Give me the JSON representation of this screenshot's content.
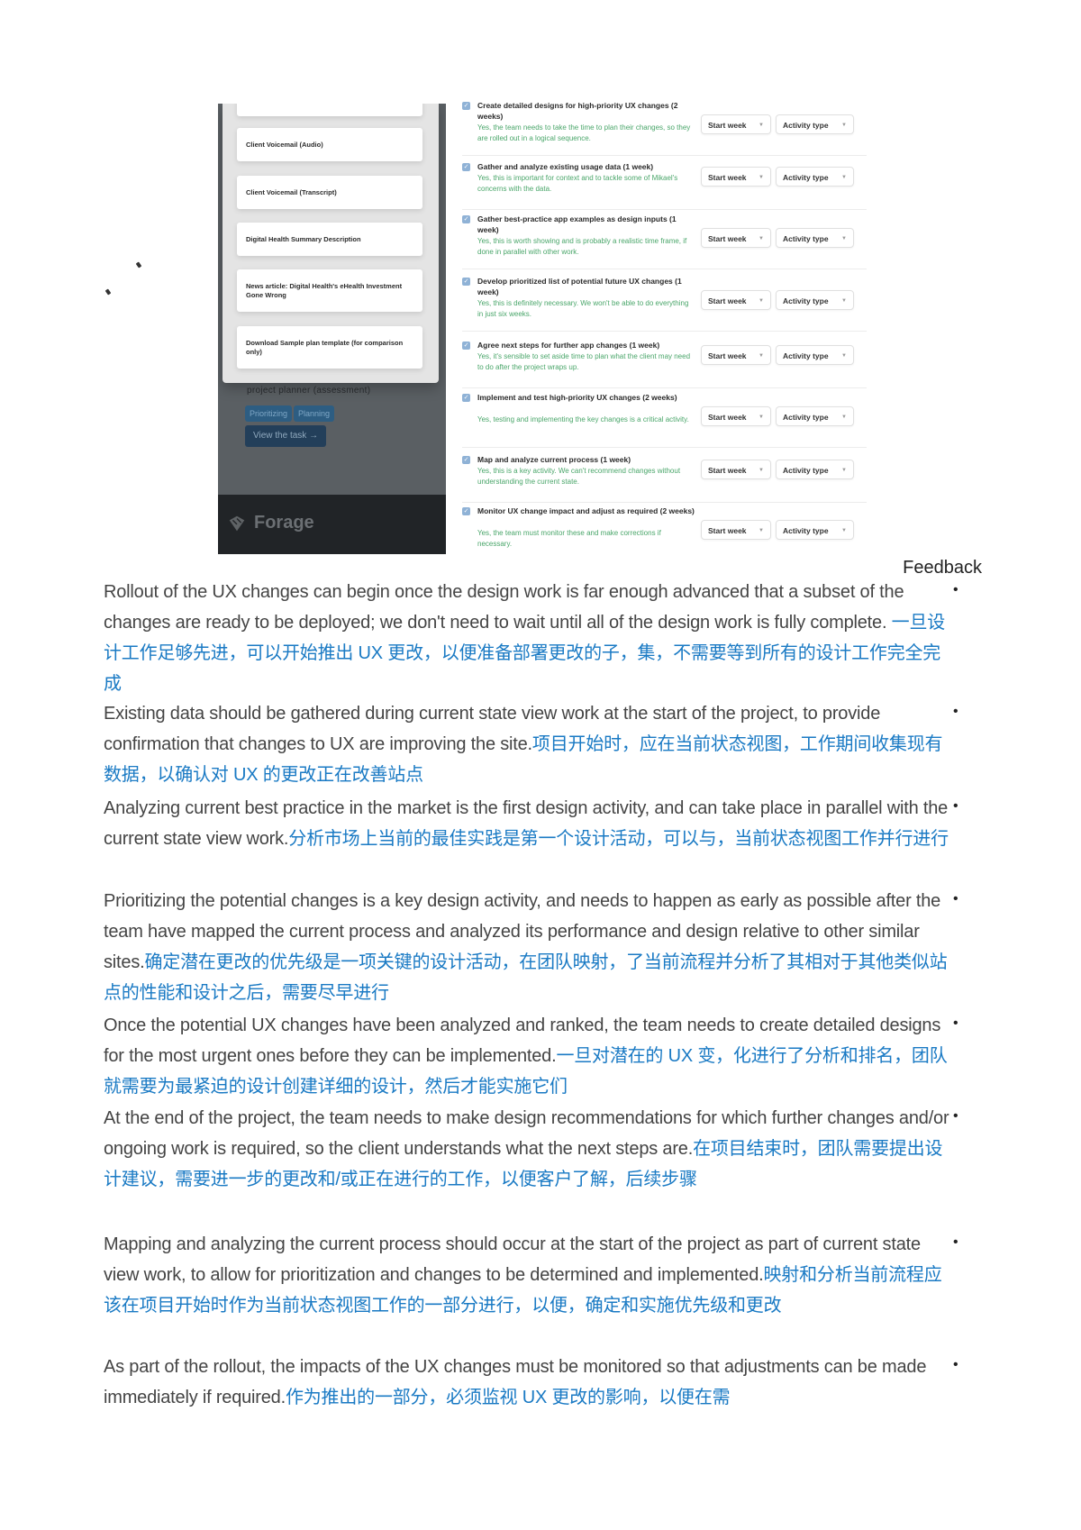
{
  "embedded_screenshot": {
    "resources": [
      "",
      "Client Voicemail (Audio)",
      "Client Voicemail (Transcript)",
      "Digital Health Summary Description",
      "News article: Digital Health's eHealth Investment Gone Wrong",
      "Download Sample plan template (for comparison only)"
    ],
    "underlay_text": "project planner (assessment)",
    "chips": [
      "Prioritizing",
      "Planning"
    ],
    "view_task_label": "View the task →",
    "brand": "Forage",
    "tasks": [
      {
        "title": "Create detailed designs for high-priority UX changes (2 weeks)",
        "feedback": "Yes, the team needs to take the time to plan their changes, so they are rolled out in a logical sequence.",
        "checked": true
      },
      {
        "title": "Gather and analyze existing usage data (1 week)",
        "feedback": "Yes, this is important for context and to tackle some of Mikael's concerns with the data.",
        "checked": true
      },
      {
        "title": "Gather best-practice app examples as design inputs (1 week)",
        "feedback": "Yes, this is worth showing and is probably a realistic time frame, if done in parallel with other work.",
        "checked": true
      },
      {
        "title": "Develop prioritized list of potential future UX changes (1 week)",
        "feedback": "Yes, this is definitely necessary. We won't be able to do everything in just six weeks.",
        "checked": true
      },
      {
        "title": "Agree next steps for further app changes (1 week)",
        "feedback": "Yes, it's sensible to set aside time to plan what the client may need to do after the project wraps up.",
        "checked": true
      },
      {
        "title": "Implement and test high-priority UX changes (2 weeks)",
        "feedback": "Yes, testing and implementing the key changes is a critical activity.",
        "checked": true
      },
      {
        "title": "Map and analyze current process (1 week)",
        "feedback": "Yes, this is a key activity. We can't recommend changes without understanding the current state.",
        "checked": true
      },
      {
        "title": "Monitor UX change impact and adjust as required (2 weeks)",
        "feedback": "Yes, the team must monitor these and make corrections if necessary.",
        "checked": true
      }
    ],
    "start_week_label": "Start week",
    "activity_type_label": "Activity type",
    "checkbox_color": "#8fb2d6",
    "feedback_color": "#4aa66a"
  },
  "feedback_section": {
    "label": "Feedback",
    "bullet": "•",
    "chinese_text_color": "#1a7ac4",
    "items": [
      {
        "en": "Rollout of the UX changes can begin once the design work is far enough advanced that a subset of the changes are ready to be deployed; we don't need to wait until all of the design work is fully complete. ",
        "cn": "一旦设计工作足够先进，可以开始推出 UX 更改，以便准备部署更改的子，集，不需要等到所有的设计工作完全完成"
      },
      {
        "en": "Existing data should be gathered during current state view work at the start of the project, to provide confirmation that changes to UX are improving the site.",
        "cn": "项目开始时，应在当前状态视图，工作期间收集现有数据，以确认对 UX 的更改正在改善站点"
      },
      {
        "en": "Analyzing current best practice in the market is the first design activity, and can take place in parallel with the current state view work.",
        "cn": "分析市场上当前的最佳实践是第一个设计活动，可以与，当前状态视图工作并行进行"
      },
      {
        "en": "Prioritizing the potential changes is a key design activity, and needs to happen as early as possible after the team have mapped the current process and analyzed its performance and design relative to other similar sites.",
        "cn": "确定潜在更改的优先级是一项关键的设计活动，在团队映射，了当前流程并分析了其相对于其他类似站点的性能和设计之后，需要尽早进行"
      },
      {
        "en": "Once the potential UX changes have been analyzed and ranked, the team needs to create detailed designs for the most urgent ones before they can be implemented.",
        "cn": "一旦对潜在的 UX 变，化进行了分析和排名，团队就需要为最紧迫的设计创建详细的设计，然后才能实施它们"
      },
      {
        "en": "At the end of the project, the team needs to make design recommendations for which further changes and/or ongoing work is required, so the client understands what the next steps are.",
        "cn": "在项目结束时，团队需要提出设计建议，需要进一步的更改和/或正在进行的工作，以便客户了解，后续步骤"
      },
      {
        "en": "Mapping and analyzing the current process should occur at the start of the project as part of current state view work, to allow for prioritization and changes to be determined and implemented.",
        "cn": "映射和分析当前流程应该在项目开始时作为当前状态视图工作的一部分进行，以便，确定和实施优先级和更改"
      },
      {
        "en": "As part of the rollout, the impacts of the UX changes must be monitored so that adjustments can be made immediately if required.",
        "cn": "作为推出的一部分，必须监视 UX 更改的影响，以便在需"
      }
    ]
  }
}
